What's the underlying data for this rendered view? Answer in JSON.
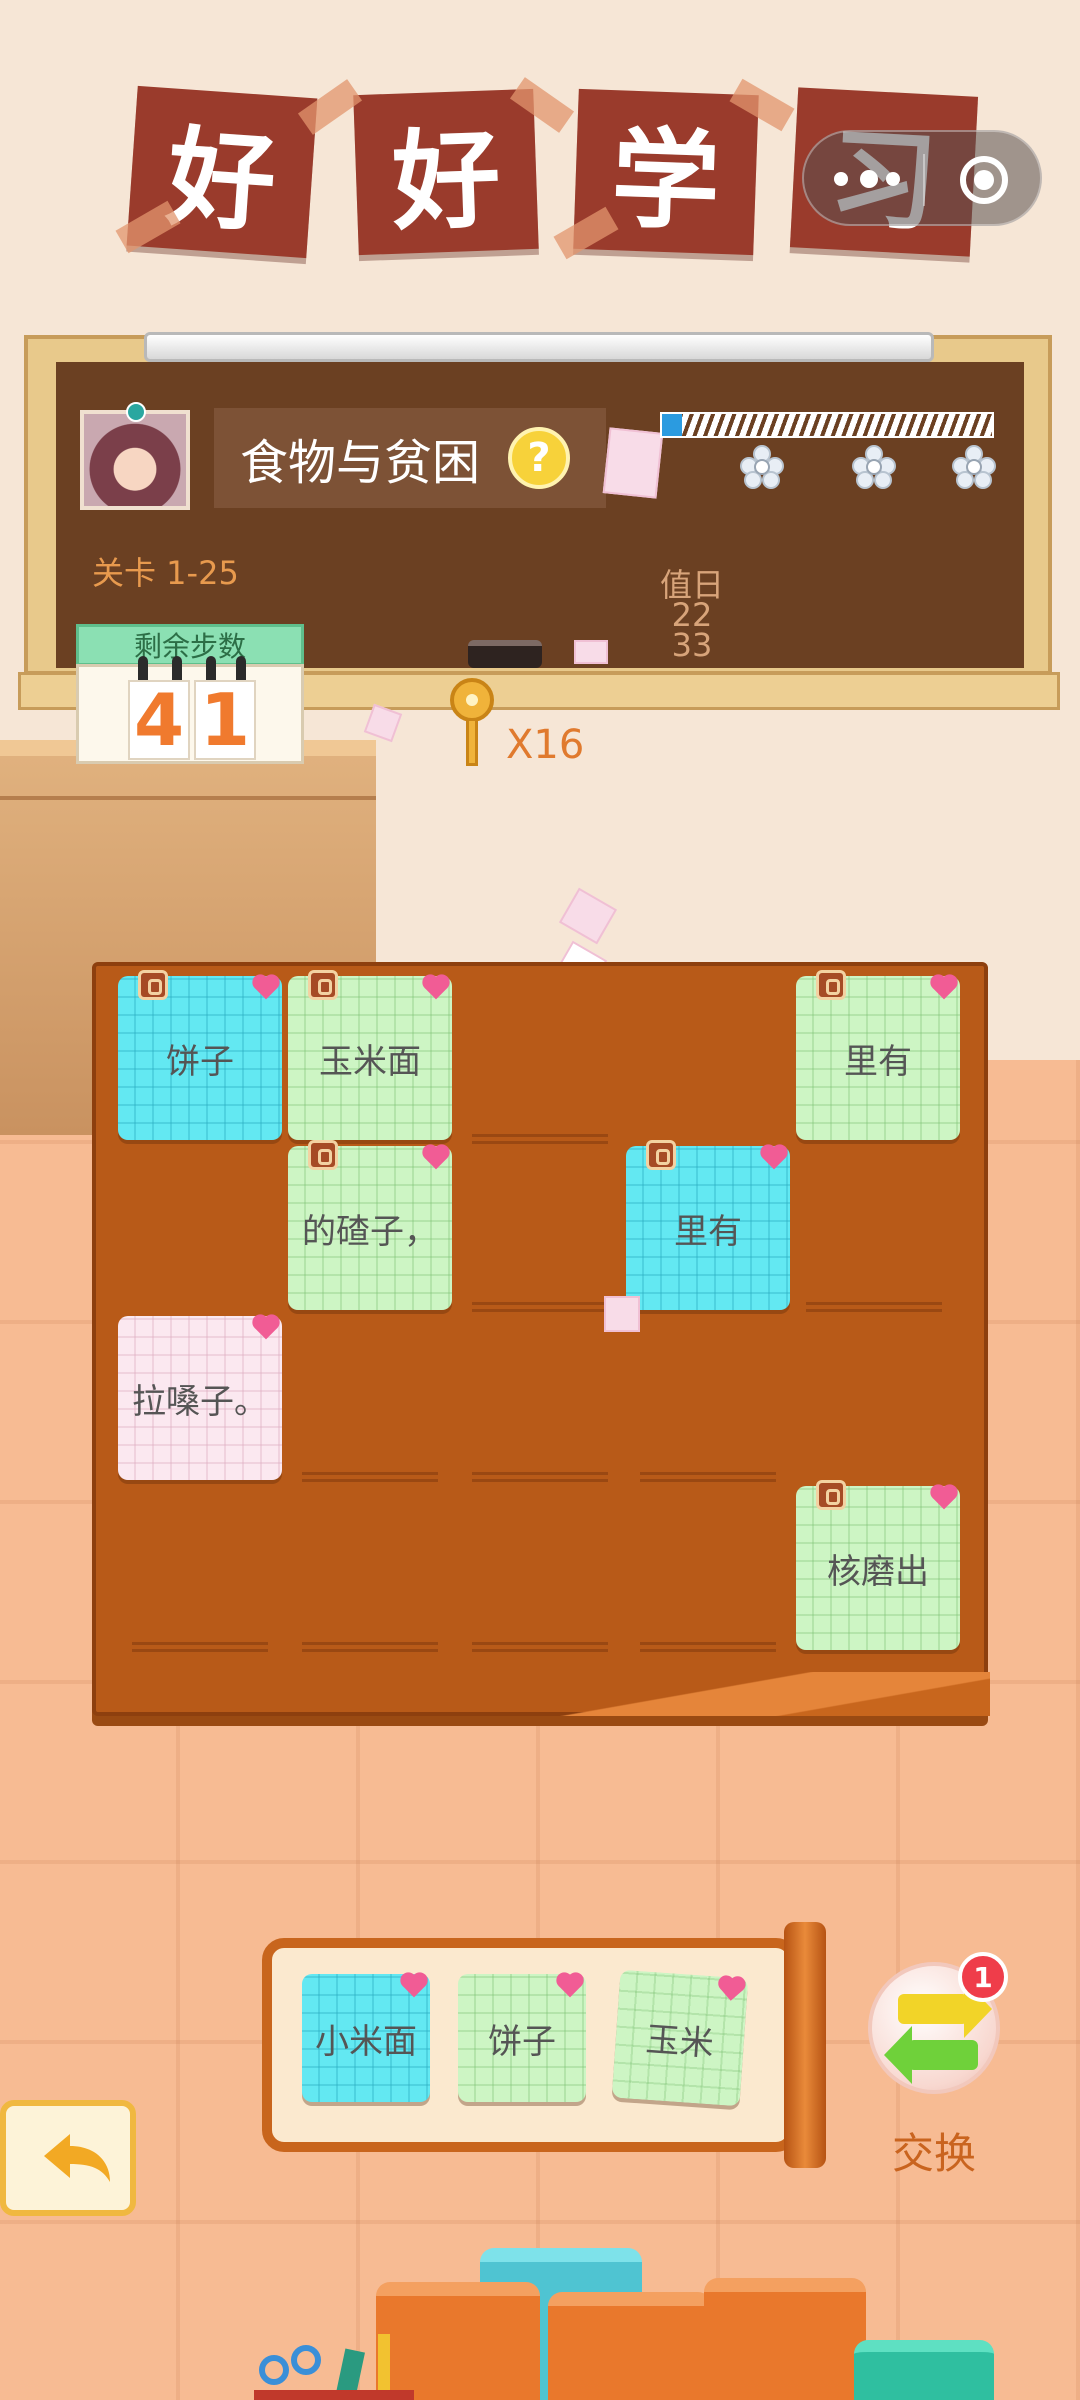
{
  "title": {
    "tiles": [
      "好",
      "好",
      "学",
      "习"
    ]
  },
  "header": {
    "topic": "食物与贫困",
    "help_icon": "question-mark-icon",
    "level": "关卡 1-25",
    "progress": 0.06,
    "chalk_note": "值日\n22\n33"
  },
  "steps": {
    "label": "剩余步数",
    "digits": [
      "4",
      "1"
    ]
  },
  "keys": {
    "count": "X16"
  },
  "board": {
    "cards": [
      {
        "text": "饼子",
        "color": "cyan",
        "locked": true
      },
      {
        "text": "玉米面",
        "color": "green",
        "locked": true
      },
      {
        "text": "里有",
        "color": "green",
        "locked": true
      },
      {
        "text": "的碴子，",
        "color": "green",
        "locked": true
      },
      {
        "text": "里有",
        "color": "cyan",
        "locked": true
      },
      {
        "text": "拉嗓子。",
        "color": "pink",
        "locked": false
      },
      {
        "text": "核磨出",
        "color": "green",
        "locked": true
      }
    ]
  },
  "tray": {
    "cards": [
      {
        "text": "小米面",
        "color": "cyan"
      },
      {
        "text": "饼子",
        "color": "green"
      },
      {
        "text": "玉米",
        "color": "green"
      }
    ]
  },
  "swap": {
    "label": "交换",
    "badge": "1"
  },
  "colors": {
    "title_tile": "#9a3b2c",
    "board_wood": "#b85a18",
    "card_green": "#cdf5c4",
    "card_cyan": "#63e8f2",
    "card_pink": "#fbe8f0",
    "accent_orange": "#e07a2e"
  }
}
